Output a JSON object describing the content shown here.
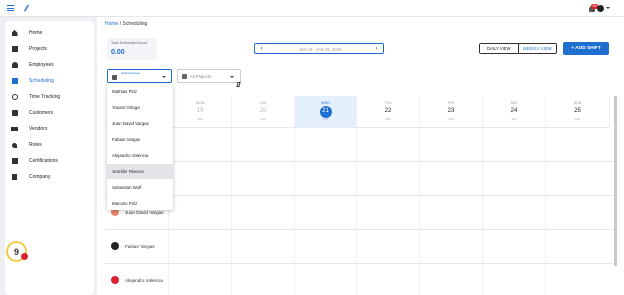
{
  "header": {
    "notification_count": "99"
  },
  "sidebar": {
    "items": [
      {
        "label": "Home",
        "icon": "home-icon"
      },
      {
        "label": "Projects",
        "icon": "grid-icon"
      },
      {
        "label": "Employees",
        "icon": "people-icon"
      },
      {
        "label": "Scheduling",
        "icon": "calendar-icon",
        "active": true
      },
      {
        "label": "Time Tracking",
        "icon": "clock-icon"
      },
      {
        "label": "Customers",
        "icon": "briefcase-icon"
      },
      {
        "label": "Vendors",
        "icon": "truck-icon"
      },
      {
        "label": "Roles",
        "icon": "key-icon"
      },
      {
        "label": "Certifications",
        "icon": "badge-icon"
      },
      {
        "label": "Company",
        "icon": "building-icon"
      }
    ],
    "help_label": "9"
  },
  "breadcrumb": {
    "home": "Home",
    "separator": "/",
    "current": "Scheduling"
  },
  "summary": {
    "title": "Total Scheduled Hours",
    "value": "0.00"
  },
  "date_nav": {
    "range": "JAN 19 - JAN 25, 2026",
    "prev": "‹",
    "next": "›"
  },
  "view_toggle": {
    "daily": "DAILY VIEW",
    "weekly": "WEEKLY VIEW"
  },
  "add_shift": {
    "label": "+ ADD SHIFT"
  },
  "filters": {
    "employees_label": "All Employees",
    "projects_placeholder": "All Projects"
  },
  "calendar": {
    "days": [
      {
        "name": "MON",
        "date": "19",
        "month": "JAN"
      },
      {
        "name": "TUE",
        "date": "20",
        "month": "JAN"
      },
      {
        "name": "WED",
        "date": "21",
        "month": "JAN",
        "today": true
      },
      {
        "name": "THU",
        "date": "22",
        "month": "JAN"
      },
      {
        "name": "FRI",
        "date": "23",
        "month": "JAN"
      },
      {
        "name": "SAT",
        "date": "24",
        "month": "JAN"
      },
      {
        "name": "SUN",
        "date": "25",
        "month": "JAN"
      }
    ],
    "rows": [
      {
        "name": "Juan David Vargas",
        "avatar_color": "#e8876b"
      },
      {
        "name": "Fabian Vargas",
        "avatar_color": "#222222"
      },
      {
        "name": "Alejandro Valencia",
        "avatar_color": "#d9232d"
      }
    ]
  },
  "dropdown": {
    "items": [
      {
        "label": "Mathias Piriz"
      },
      {
        "label": "Yovani Ortega"
      },
      {
        "label": "Juan David Vargas"
      },
      {
        "label": "Fabian Vargas"
      },
      {
        "label": "Alejandro Valencia"
      },
      {
        "label": "Jennifer Riveros",
        "hover": true
      },
      {
        "label": "Sebastian Wolf"
      },
      {
        "label": "Marcelo Piriz"
      }
    ]
  },
  "colors": {
    "accent": "#1f6fd1",
    "alert": "#d9232d"
  }
}
